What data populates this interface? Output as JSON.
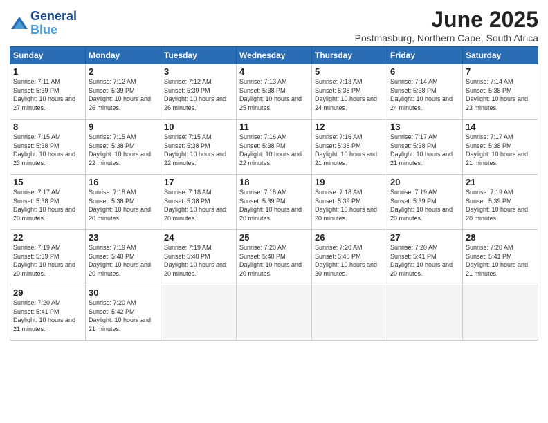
{
  "header": {
    "logo_line1": "General",
    "logo_line2": "Blue",
    "month_year": "June 2025",
    "location": "Postmasburg, Northern Cape, South Africa"
  },
  "days_of_week": [
    "Sunday",
    "Monday",
    "Tuesday",
    "Wednesday",
    "Thursday",
    "Friday",
    "Saturday"
  ],
  "weeks": [
    [
      {
        "day": 1,
        "rise": "7:11 AM",
        "set": "5:39 PM",
        "daylight": "10 hours and 27 minutes."
      },
      {
        "day": 2,
        "rise": "7:12 AM",
        "set": "5:39 PM",
        "daylight": "10 hours and 26 minutes."
      },
      {
        "day": 3,
        "rise": "7:12 AM",
        "set": "5:39 PM",
        "daylight": "10 hours and 26 minutes."
      },
      {
        "day": 4,
        "rise": "7:13 AM",
        "set": "5:38 PM",
        "daylight": "10 hours and 25 minutes."
      },
      {
        "day": 5,
        "rise": "7:13 AM",
        "set": "5:38 PM",
        "daylight": "10 hours and 24 minutes."
      },
      {
        "day": 6,
        "rise": "7:14 AM",
        "set": "5:38 PM",
        "daylight": "10 hours and 24 minutes."
      },
      {
        "day": 7,
        "rise": "7:14 AM",
        "set": "5:38 PM",
        "daylight": "10 hours and 23 minutes."
      }
    ],
    [
      {
        "day": 8,
        "rise": "7:15 AM",
        "set": "5:38 PM",
        "daylight": "10 hours and 23 minutes."
      },
      {
        "day": 9,
        "rise": "7:15 AM",
        "set": "5:38 PM",
        "daylight": "10 hours and 22 minutes."
      },
      {
        "day": 10,
        "rise": "7:15 AM",
        "set": "5:38 PM",
        "daylight": "10 hours and 22 minutes."
      },
      {
        "day": 11,
        "rise": "7:16 AM",
        "set": "5:38 PM",
        "daylight": "10 hours and 22 minutes."
      },
      {
        "day": 12,
        "rise": "7:16 AM",
        "set": "5:38 PM",
        "daylight": "10 hours and 21 minutes."
      },
      {
        "day": 13,
        "rise": "7:17 AM",
        "set": "5:38 PM",
        "daylight": "10 hours and 21 minutes."
      },
      {
        "day": 14,
        "rise": "7:17 AM",
        "set": "5:38 PM",
        "daylight": "10 hours and 21 minutes."
      }
    ],
    [
      {
        "day": 15,
        "rise": "7:17 AM",
        "set": "5:38 PM",
        "daylight": "10 hours and 20 minutes."
      },
      {
        "day": 16,
        "rise": "7:18 AM",
        "set": "5:38 PM",
        "daylight": "10 hours and 20 minutes."
      },
      {
        "day": 17,
        "rise": "7:18 AM",
        "set": "5:38 PM",
        "daylight": "10 hours and 20 minutes."
      },
      {
        "day": 18,
        "rise": "7:18 AM",
        "set": "5:39 PM",
        "daylight": "10 hours and 20 minutes."
      },
      {
        "day": 19,
        "rise": "7:18 AM",
        "set": "5:39 PM",
        "daylight": "10 hours and 20 minutes."
      },
      {
        "day": 20,
        "rise": "7:19 AM",
        "set": "5:39 PM",
        "daylight": "10 hours and 20 minutes."
      },
      {
        "day": 21,
        "rise": "7:19 AM",
        "set": "5:39 PM",
        "daylight": "10 hours and 20 minutes."
      }
    ],
    [
      {
        "day": 22,
        "rise": "7:19 AM",
        "set": "5:39 PM",
        "daylight": "10 hours and 20 minutes."
      },
      {
        "day": 23,
        "rise": "7:19 AM",
        "set": "5:40 PM",
        "daylight": "10 hours and 20 minutes."
      },
      {
        "day": 24,
        "rise": "7:19 AM",
        "set": "5:40 PM",
        "daylight": "10 hours and 20 minutes."
      },
      {
        "day": 25,
        "rise": "7:20 AM",
        "set": "5:40 PM",
        "daylight": "10 hours and 20 minutes."
      },
      {
        "day": 26,
        "rise": "7:20 AM",
        "set": "5:40 PM",
        "daylight": "10 hours and 20 minutes."
      },
      {
        "day": 27,
        "rise": "7:20 AM",
        "set": "5:41 PM",
        "daylight": "10 hours and 20 minutes."
      },
      {
        "day": 28,
        "rise": "7:20 AM",
        "set": "5:41 PM",
        "daylight": "10 hours and 21 minutes."
      }
    ],
    [
      {
        "day": 29,
        "rise": "7:20 AM",
        "set": "5:41 PM",
        "daylight": "10 hours and 21 minutes."
      },
      {
        "day": 30,
        "rise": "7:20 AM",
        "set": "5:42 PM",
        "daylight": "10 hours and 21 minutes."
      },
      null,
      null,
      null,
      null,
      null
    ]
  ]
}
